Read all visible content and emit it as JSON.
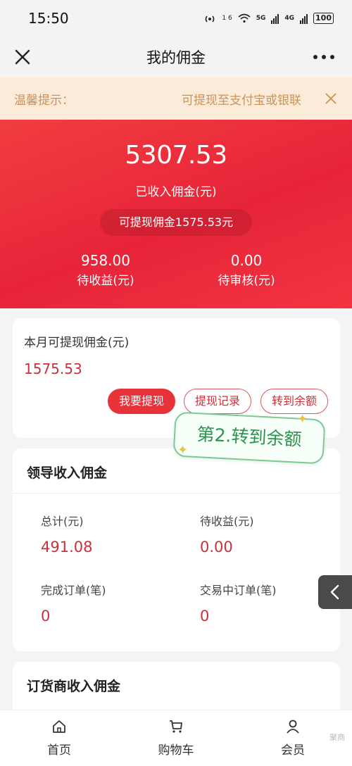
{
  "status_bar": {
    "time": "15:50",
    "net1": "5G",
    "net2": "4G",
    "battery": "100",
    "signal_label": "1 6"
  },
  "nav": {
    "title": "我的佣金",
    "close_icon": "close-icon",
    "more_icon": "more-icon"
  },
  "notice": {
    "label": "温馨提示：",
    "text": "可提现至支付宝或银联",
    "close_icon": "close-icon"
  },
  "hero": {
    "amount": "5307.53",
    "caption": "已收入佣金(元)",
    "withdrawable_pill": "可提现佣金1575.53元",
    "pending_value": "958.00",
    "pending_label": "待收益(元)",
    "review_value": "0.00",
    "review_label": "待审核(元)"
  },
  "withdraw_card": {
    "title": "本月可提现佣金(元)",
    "amount": "1575.53",
    "btn_withdraw": "我要提现",
    "btn_records": "提现记录",
    "btn_transfer": "转到余额"
  },
  "tip_tag": "第2.转到余额",
  "leader": {
    "title": "领导收入佣金",
    "total_label": "总计(元)",
    "total_value": "491.08",
    "pending_label": "待收益(元)",
    "pending_value": "0.00",
    "done_label": "完成订单(笔)",
    "done_value": "0",
    "trading_label": "交易中订单(笔)",
    "trading_value": "0"
  },
  "agent": {
    "title": "订货商收入佣金"
  },
  "side_tab_icon": "chevron-left-icon",
  "tabs": [
    {
      "label": "首页",
      "icon": "home-icon"
    },
    {
      "label": "购物车",
      "icon": "cart-icon"
    },
    {
      "label": "会员",
      "icon": "user-icon"
    }
  ],
  "watermark": "聚商"
}
